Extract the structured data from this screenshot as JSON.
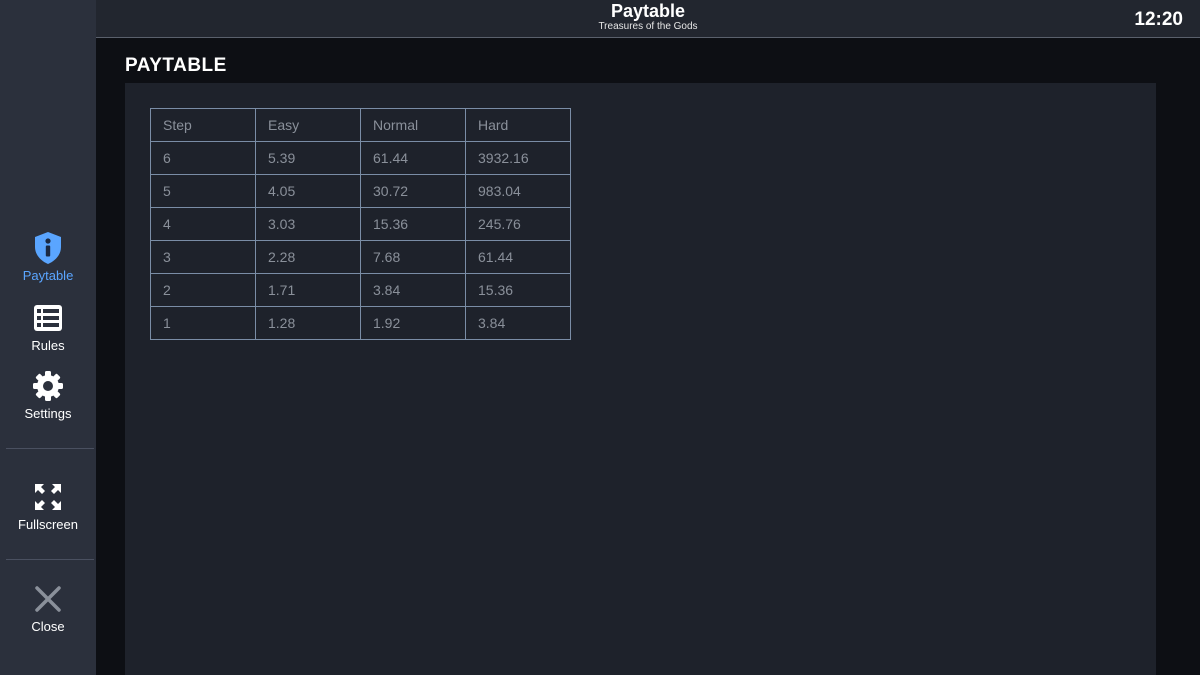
{
  "header": {
    "title": "Paytable",
    "subtitle": "Treasures of the Gods",
    "clock": "12:20"
  },
  "sidebar": {
    "items": [
      {
        "label": "Paytable",
        "icon": "info-shield-icon",
        "active": true
      },
      {
        "label": "Rules",
        "icon": "list-icon"
      },
      {
        "label": "Settings",
        "icon": "gear-icon"
      },
      {
        "label": "Fullscreen",
        "icon": "expand-icon"
      },
      {
        "label": "Close",
        "icon": "close-icon"
      }
    ]
  },
  "main": {
    "title": "PAYTABLE",
    "table": {
      "headers": [
        "Step",
        "Easy",
        "Normal",
        "Hard"
      ],
      "rows": [
        [
          "6",
          "5.39",
          "61.44",
          "3932.16"
        ],
        [
          "5",
          "4.05",
          "30.72",
          "983.04"
        ],
        [
          "4",
          "3.03",
          "15.36",
          "245.76"
        ],
        [
          "3",
          "2.28",
          "7.68",
          "61.44"
        ],
        [
          "2",
          "1.71",
          "3.84",
          "15.36"
        ],
        [
          "1",
          "1.28",
          "1.92",
          "3.84"
        ]
      ]
    }
  },
  "colors": {
    "accent": "#5aa5ff",
    "sidebar": "#2b303c",
    "panel": "#1e222b",
    "table_border": "#7a8da6"
  }
}
